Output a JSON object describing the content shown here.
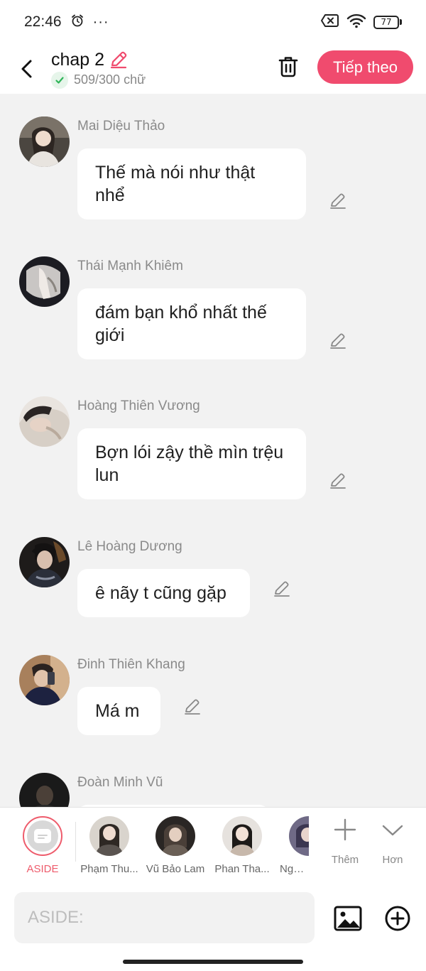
{
  "status_bar": {
    "time": "22:46",
    "more": "···",
    "battery_level": "77"
  },
  "header": {
    "title": "chap 2",
    "word_count": "509/300 chữ",
    "next_button": "Tiếp theo",
    "accent_color": "#f04b6e"
  },
  "messages": [
    {
      "sender": "Mai Diệu Thảo",
      "text": "Thế mà nói như thật nhể"
    },
    {
      "sender": "Thái Mạnh Khiêm",
      "text": "đám bạn khổ nhất thế giới"
    },
    {
      "sender": "Hoàng Thiên Vương",
      "text": "Bợn lói zậy thề mìn trệu lun"
    },
    {
      "sender": "Lê Hoàng Dương",
      "text": "ê nãy t cũng gặp"
    },
    {
      "sender": "Đinh Thiên Khang",
      "text": "Má m"
    },
    {
      "sender": "Đoàn Minh Vũ",
      "text": ""
    }
  ],
  "characters": {
    "aside_label": "ASIDE",
    "items": [
      {
        "name": "Phạm Thu..."
      },
      {
        "name": "Vũ Bảo Lam"
      },
      {
        "name": "Phan Tha..."
      },
      {
        "name": "Ngô G"
      }
    ],
    "add_label": "Thêm",
    "more_label": "Hơn"
  },
  "input": {
    "placeholder": "ASIDE:"
  }
}
